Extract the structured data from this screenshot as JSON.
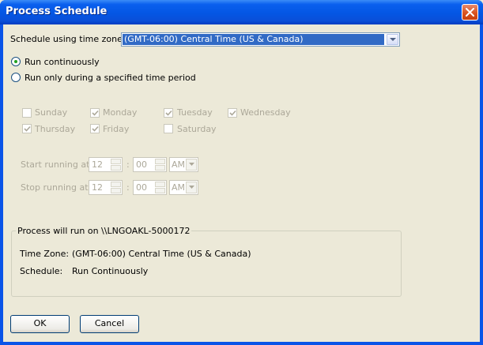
{
  "window": {
    "title": "Process Schedule",
    "close_icon": "close-icon"
  },
  "timezone": {
    "label": "Schedule using time zone:",
    "selected": "(GMT-06:00) Central Time (US & Canada)"
  },
  "mode": {
    "continuous_label": "Run continuously",
    "period_label": "Run only during a specified time period",
    "selected": "continuous"
  },
  "days": [
    {
      "label": "Sunday",
      "checked": false
    },
    {
      "label": "Monday",
      "checked": true
    },
    {
      "label": "Tuesday",
      "checked": true
    },
    {
      "label": "Wednesday",
      "checked": true
    },
    {
      "label": "Thursday",
      "checked": true
    },
    {
      "label": "Friday",
      "checked": true
    },
    {
      "label": "Saturday",
      "checked": false
    }
  ],
  "start": {
    "label": "Start running at:",
    "hour": "12",
    "separator": ":",
    "minute": "00",
    "ampm": "AM"
  },
  "stop": {
    "label": "Stop running at:",
    "hour": "12",
    "separator": ":",
    "minute": "00",
    "ampm": "AM"
  },
  "summary": {
    "caption": "Process will run on \\\\LNGOAKL-5000172",
    "timezone_label": "Time Zone:",
    "timezone_value": "(GMT-06:00) Central Time (US & Canada)",
    "schedule_label": "Schedule:",
    "schedule_value": "Run Continuously"
  },
  "buttons": {
    "ok": "OK",
    "cancel": "Cancel"
  },
  "colors": {
    "titlebar": "#0456e4",
    "selection": "#316ac5",
    "dialog_bg": "#ece9d8",
    "disabled_text": "#aca899",
    "radio_dot": "#21a121"
  }
}
